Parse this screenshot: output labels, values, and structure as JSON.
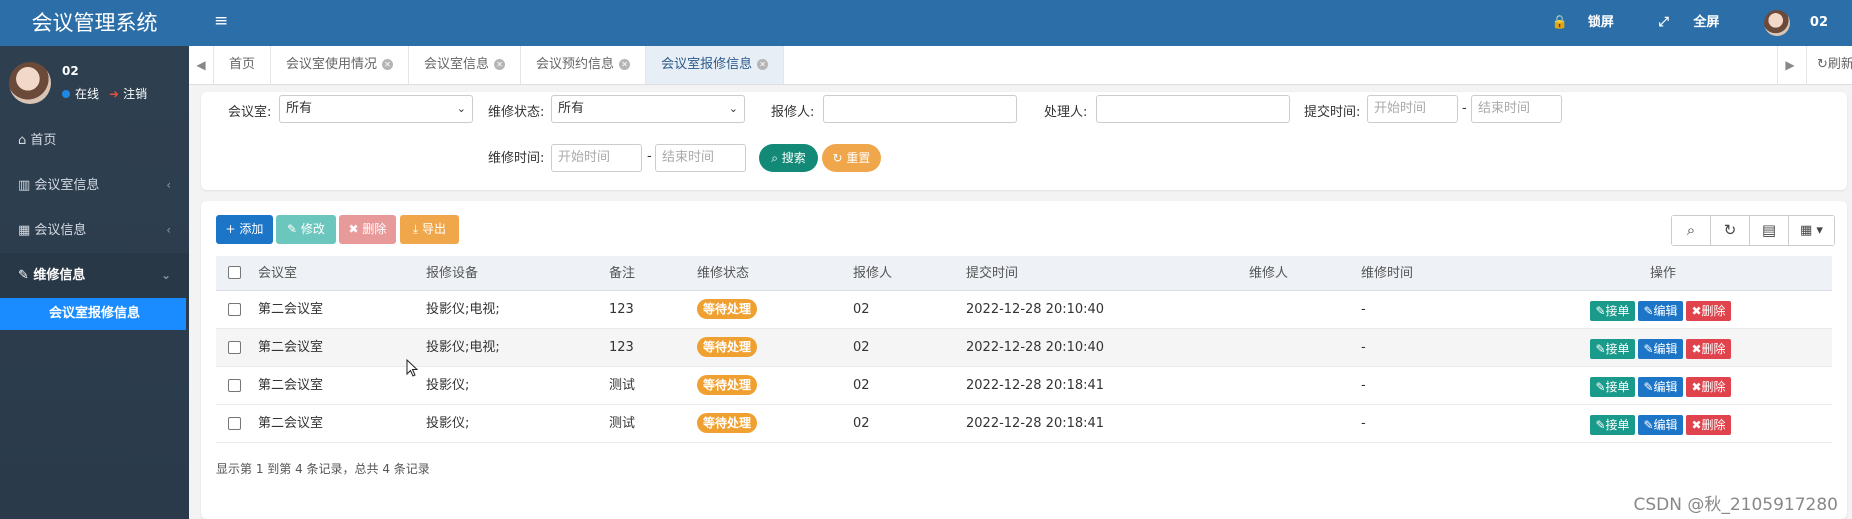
{
  "app": {
    "title": "会议管理系统"
  },
  "profile": {
    "name": "02",
    "online": "在线",
    "logout": "注销"
  },
  "sidebar": {
    "items": [
      {
        "icon": "home-icon",
        "label": "首页",
        "has_arrow": false
      },
      {
        "icon": "bank-icon",
        "label": "会议室信息",
        "has_arrow": true
      },
      {
        "icon": "calendar-icon",
        "label": "会议信息",
        "has_arrow": true
      },
      {
        "icon": "wrench-icon",
        "label": "维修信息",
        "has_arrow": true
      }
    ],
    "sub_item": "会议室报修信息"
  },
  "topbar": {
    "lock": "锁屏",
    "fullscreen": "全屏",
    "user": "02"
  },
  "tabs": {
    "items": [
      {
        "label": "首页",
        "closable": false
      },
      {
        "label": "会议室使用情况",
        "closable": true
      },
      {
        "label": "会议室信息",
        "closable": true
      },
      {
        "label": "会议预约信息",
        "closable": true
      },
      {
        "label": "会议室报修信息",
        "closable": true
      }
    ],
    "refresh": "刷新"
  },
  "search": {
    "room_label": "会议室:",
    "room_value": "所有",
    "status_label": "维修状态:",
    "status_value": "所有",
    "reporter_label": "报修人:",
    "handler_label": "处理人:",
    "submit_time_label": "提交时间:",
    "repair_time_label": "维修时间:",
    "start_placeholder": "开始时间",
    "end_placeholder": "结束时间",
    "dash": "-",
    "search_btn": "搜索",
    "reset_btn": "重置"
  },
  "toolbar": {
    "add": "添加",
    "edit": "修改",
    "delete": "删除",
    "export": "导出"
  },
  "table": {
    "headers": [
      "会议室",
      "报修设备",
      "备注",
      "维修状态",
      "报修人",
      "提交时间",
      "维修人",
      "维修时间",
      "操作"
    ],
    "rows": [
      {
        "room": "第二会议室",
        "device": "投影仪;电视;",
        "note": "123",
        "status": "等待处理",
        "reporter": "02",
        "submit": "2022-12-28 20:10:40",
        "repairer": "",
        "repair_time": "-"
      },
      {
        "room": "第二会议室",
        "device": "投影仪;电视;",
        "note": "123",
        "status": "等待处理",
        "reporter": "02",
        "submit": "2022-12-28 20:10:40",
        "repairer": "",
        "repair_time": "-"
      },
      {
        "room": "第二会议室",
        "device": "投影仪;",
        "note": "测试",
        "status": "等待处理",
        "reporter": "02",
        "submit": "2022-12-28 20:18:41",
        "repairer": "",
        "repair_time": "-"
      },
      {
        "room": "第二会议室",
        "device": "投影仪;",
        "note": "测试",
        "status": "等待处理",
        "reporter": "02",
        "submit": "2022-12-28 20:18:41",
        "repairer": "",
        "repair_time": "-"
      }
    ],
    "ops": {
      "accept": "接单",
      "edit": "编辑",
      "delete": "删除"
    }
  },
  "pager": "显示第 1 到第 4 条记录，总共 4 条记录",
  "watermark": "CSDN @秋_2105917280",
  "colors": {
    "primary": "#2c6fa8",
    "add": "#1c75c7",
    "edit": "#6bc6be",
    "delete": "#e89a9a",
    "export": "#f0a64a",
    "search": "#138a78",
    "reset": "#f0a64a",
    "accept": "#1a9a8a",
    "op_edit": "#1c75c7",
    "op_delete": "#e0434b",
    "badge": "#f0a030"
  }
}
